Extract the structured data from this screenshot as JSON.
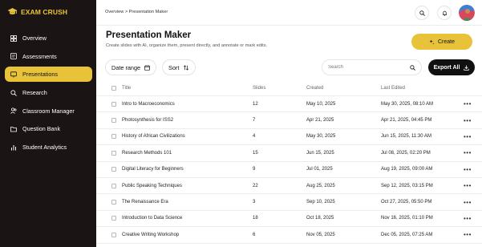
{
  "app": {
    "name": "EXAM CRUSH"
  },
  "sidebar": {
    "items": [
      {
        "label": "Overview",
        "icon": "dashboard-icon",
        "active": false
      },
      {
        "label": "Assessments",
        "icon": "assessment-icon",
        "active": false
      },
      {
        "label": "Presentations",
        "icon": "presentation-icon",
        "active": true
      },
      {
        "label": "Research",
        "icon": "search-icon",
        "active": false
      },
      {
        "label": "Classroom Manager",
        "icon": "users-icon",
        "active": false
      },
      {
        "label": "Question Bank",
        "icon": "folder-icon",
        "active": false
      },
      {
        "label": "Student Analytics",
        "icon": "bar-chart-icon",
        "active": false
      }
    ]
  },
  "topbar": {
    "breadcrumb": "Overview > Presentation Maker"
  },
  "page": {
    "title": "Presentation Maker",
    "subtitle": "Create slides with AI, organize them, present directly, and annotate or mark edits.",
    "create_label": "Create"
  },
  "toolbar": {
    "date_range_label": "Date range",
    "sort_label": "Sort",
    "search_placeholder": "Search",
    "export_label": "Export All"
  },
  "table": {
    "columns": {
      "title": "Title",
      "slides": "Slides",
      "created": "Created",
      "edited": "Last Edited"
    },
    "rows": [
      {
        "title": "Intro to Macroeconomics",
        "slides": "12",
        "created": "May 10, 2025",
        "edited": "May 30, 2025, 08:10 AM",
        "more": "•••"
      },
      {
        "title": "Photosynthesis for ISS2",
        "slides": "7",
        "created": "Apr 21, 2025",
        "edited": "Apr 21, 2025, 04:45 PM",
        "more": "•••"
      },
      {
        "title": "History of African Civilizations",
        "slides": "4",
        "created": "May 30, 2025",
        "edited": "Jun 15, 2025, 11:30 AM",
        "more": "•••"
      },
      {
        "title": "Research Methods 101",
        "slides": "15",
        "created": "Jun 15, 2025",
        "edited": "Jul 08, 2025, 02:20 PM",
        "more": "•••"
      },
      {
        "title": "Digital Literacy for Beginners",
        "slides": "9",
        "created": "Jul 01, 2025",
        "edited": "Aug 19, 2025, 09:00 AM",
        "more": "•••"
      },
      {
        "title": "Public Speaking Techniques",
        "slides": "22",
        "created": "Aug 25, 2025",
        "edited": "Sep 12, 2025, 03:15 PM",
        "more": "•••"
      },
      {
        "title": "The Renaissance Era",
        "slides": "3",
        "created": "Sep 10, 2025",
        "edited": "Oct 27, 2025, 05:50 PM",
        "more": "•••"
      },
      {
        "title": "Introduction to Data Science",
        "slides": "18",
        "created": "Oct 18, 2025",
        "edited": "Nov 16, 2025, 01:10 PM",
        "more": "•••"
      },
      {
        "title": "Creative Writing Workshop",
        "slides": "6",
        "created": "Nov 05, 2025",
        "edited": "Dec 05, 2025, 07:25 AM",
        "more": "•••"
      }
    ]
  },
  "colors": {
    "accent": "#e8c33a",
    "sidebar_bg": "#1a1414",
    "export_bg": "#111111"
  }
}
